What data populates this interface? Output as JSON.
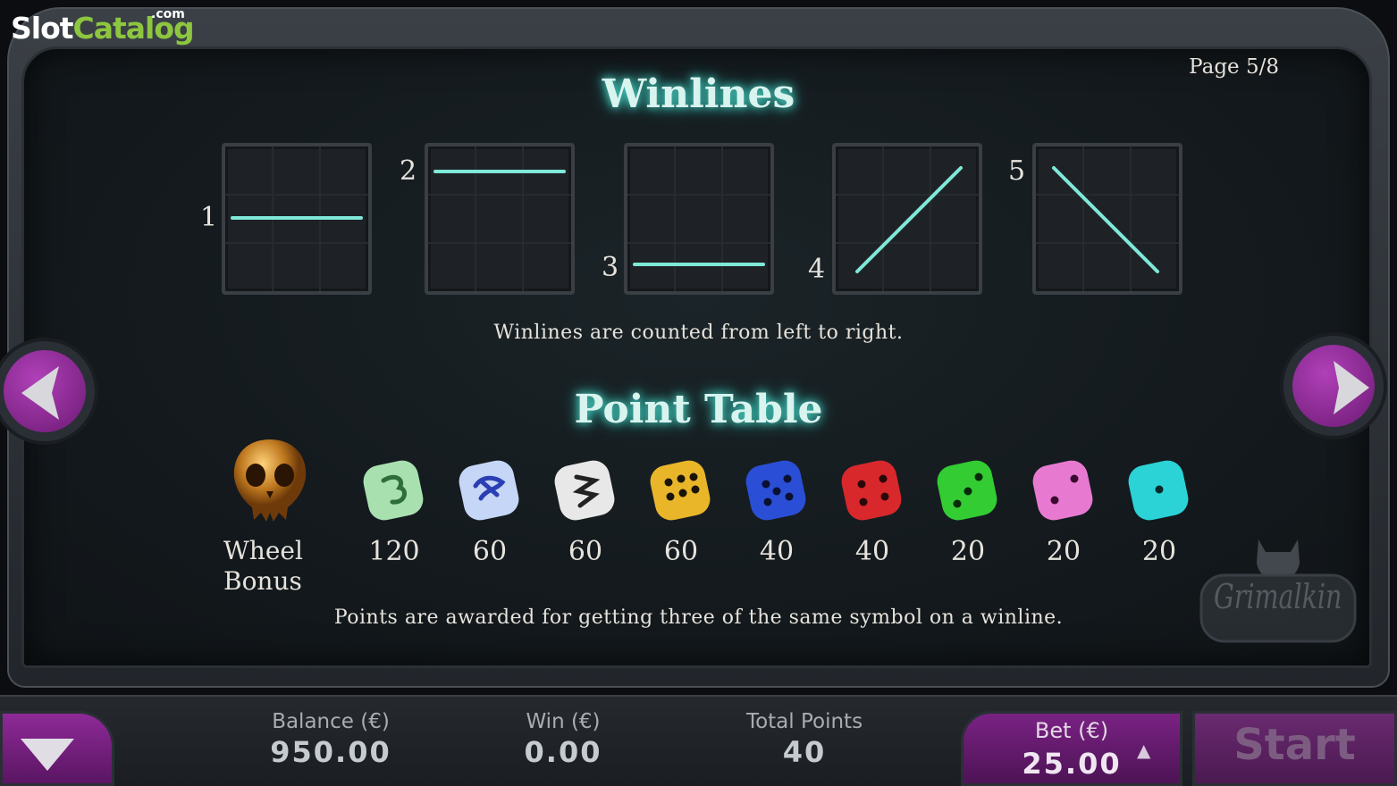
{
  "brand": {
    "slot": "Slot",
    "catalog": "Catalog",
    "com": ".com"
  },
  "page_indicator": "Page  5/8",
  "winlines": {
    "title": "Winlines",
    "lines": [
      {
        "number": "1",
        "shape": "middle-row"
      },
      {
        "number": "2",
        "shape": "top-row"
      },
      {
        "number": "3",
        "shape": "bottom-row"
      },
      {
        "number": "4",
        "shape": "diagonal-up"
      },
      {
        "number": "5",
        "shape": "diagonal-down"
      }
    ],
    "note": "Winlines are counted from left to right."
  },
  "point_table": {
    "title": "Point Table",
    "bonus": {
      "icon": "golden-cat-skull-icon",
      "label_line1": "Wheel",
      "label_line2": "Bonus"
    },
    "symbols": [
      {
        "icon": "green-rune-die-icon",
        "color": "#a8e0b0",
        "points": "120"
      },
      {
        "icon": "blue-rune-die-icon",
        "color": "#9fb8ef",
        "points": "60"
      },
      {
        "icon": "white-rune-die-icon",
        "color": "#e8e8e8",
        "points": "60"
      },
      {
        "icon": "yellow-die-icon",
        "color": "#e9b62a",
        "points": "60"
      },
      {
        "icon": "blue-die-icon",
        "color": "#2a4fd6",
        "points": "40"
      },
      {
        "icon": "red-die-icon",
        "color": "#d8282c",
        "points": "40"
      },
      {
        "icon": "green-die-icon",
        "color": "#33cc33",
        "points": "20"
      },
      {
        "icon": "pink-die-icon",
        "color": "#e77ad0",
        "points": "20"
      },
      {
        "icon": "cyan-die-icon",
        "color": "#2bd3d6",
        "points": "20"
      }
    ],
    "note": "Points are awarded for getting three of the same symbol on a winline."
  },
  "game_logo": "Grimalkin",
  "bottom_bar": {
    "balance_label": "Balance (€)",
    "balance_value": "950.00",
    "win_label": "Win (€)",
    "win_value": "0.00",
    "total_points_label": "Total Points",
    "total_points_value": "40",
    "bet_label": "Bet  (€)",
    "bet_value": "25.00",
    "start_label": "Start"
  },
  "colors": {
    "accent_purple": "#8e2a98",
    "glow_cyan": "#4fe0d0"
  }
}
